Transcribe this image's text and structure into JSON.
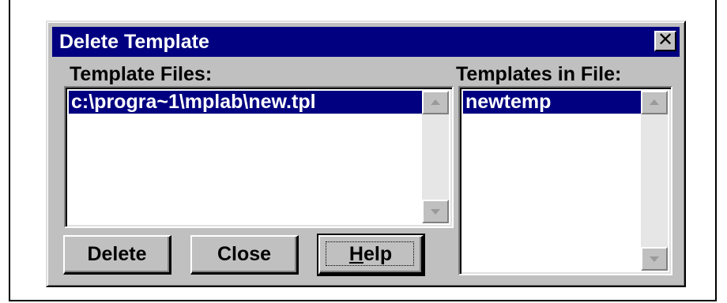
{
  "dialog": {
    "title": "Delete Template",
    "close_glyph": "✕"
  },
  "template_files": {
    "label": "Template Files:",
    "items": [
      "c:\\progra~1\\mplab\\new.tpl"
    ]
  },
  "templates_in_file": {
    "label": "Templates in File:",
    "items": [
      "newtemp"
    ]
  },
  "buttons": {
    "delete": "Delete",
    "close": "Close",
    "help_mnemonic": "H",
    "help_rest": "elp"
  },
  "colors": {
    "titlebar": "#000080",
    "face": "#c0c0c0",
    "selection": "#000080"
  },
  "icons": {
    "close": "close-icon",
    "scroll_up": "arrow-up-icon",
    "scroll_down": "arrow-down-icon"
  }
}
